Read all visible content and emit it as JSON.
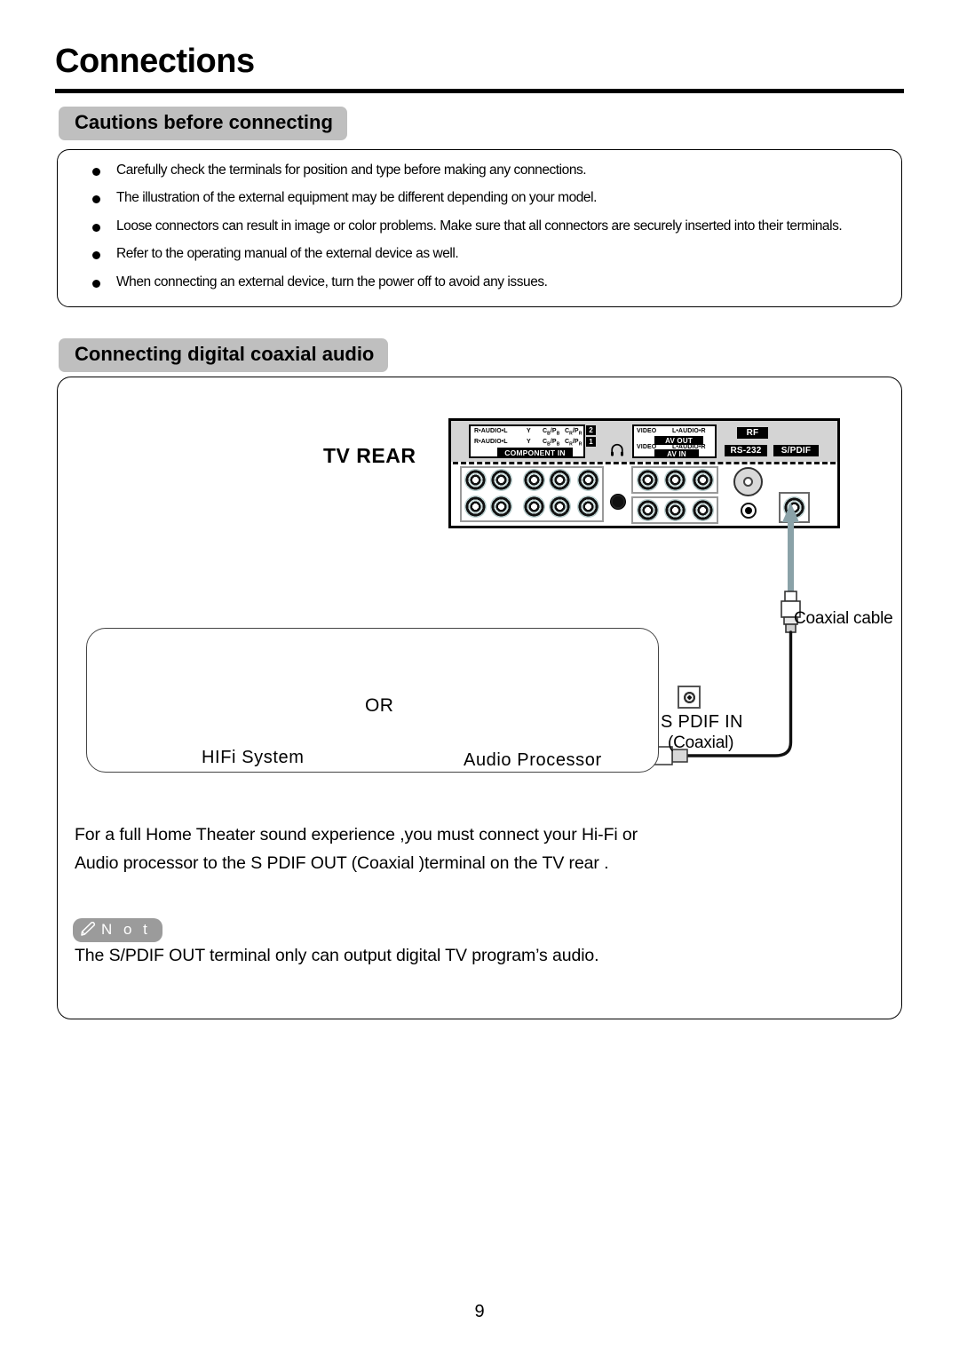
{
  "document": {
    "title": "Connections",
    "page_number": "9"
  },
  "sections": {
    "cautions_heading": "Cautions before connecting",
    "coaxial_heading": "Connecting digital coaxial audio"
  },
  "cautions": {
    "items": [
      "Carefully check the terminals for position and type before making any connections.",
      "The illustration of the external equipment may be different depending on your model.",
      "Loose connectors can result in image or color problems. Make sure that all connectors are securely inserted into their terminals.",
      "Refer to the operating manual of the external device as well.",
      "When connecting an external device, turn the power off to avoid any issues."
    ]
  },
  "diagram": {
    "tv_rear_label": "TV REAR",
    "panel": {
      "component_in": {
        "title": "COMPONENT IN",
        "rows": [
          {
            "number": "2",
            "audio": "R•AUDIO•L",
            "y": "Y",
            "cb": "C",
            "cb_sub": "B",
            "pb": "P",
            "pb_sub": "B",
            "cr": "C",
            "cr_sub": "R",
            "pr": "P",
            "pr_sub": "R"
          },
          {
            "number": "1",
            "audio": "R•AUDIO•L",
            "y": "Y",
            "cb": "C",
            "cb_sub": "B",
            "pb": "P",
            "pb_sub": "B",
            "cr": "C",
            "cr_sub": "R",
            "pr": "P",
            "pr_sub": "R"
          }
        ]
      },
      "headphone_icon": "headphone-icon",
      "av_out": {
        "title": "AV OUT",
        "video": "VIDEO",
        "audio": "L•AUDIO•R"
      },
      "av_in": {
        "title": "AV IN",
        "video": "VIDEO",
        "audio": "L•AUDIO•R"
      },
      "rf_label": "RF",
      "rs232_label": "RS-232",
      "spdif_label": "S/PDIF"
    },
    "coaxial_cable_label": "Coaxial cable",
    "spdif_in_label": "S PDIF IN",
    "spdif_in_sub_label": "(Coaxial)",
    "or_label": "OR",
    "hifi_label": "HIFi  System",
    "audio_processor_label": "Audio  Processor"
  },
  "body": {
    "paragraph": "For a full Home Theater sound experience ,you must connect your Hi-Fi or Audio processor to the S PDIF OUT (Coaxial )terminal on the TV rear ."
  },
  "note": {
    "badge_label": "N o t",
    "icon": "pencil-icon",
    "text": "The S/PDIF OUT terminal only can output digital TV program’s audio."
  },
  "colors": {
    "heading_badge": "#bfbfbf",
    "note_badge": "#9b9b9b",
    "panel_top": "#d4d4d4",
    "arrow": "#8aa2a8"
  }
}
